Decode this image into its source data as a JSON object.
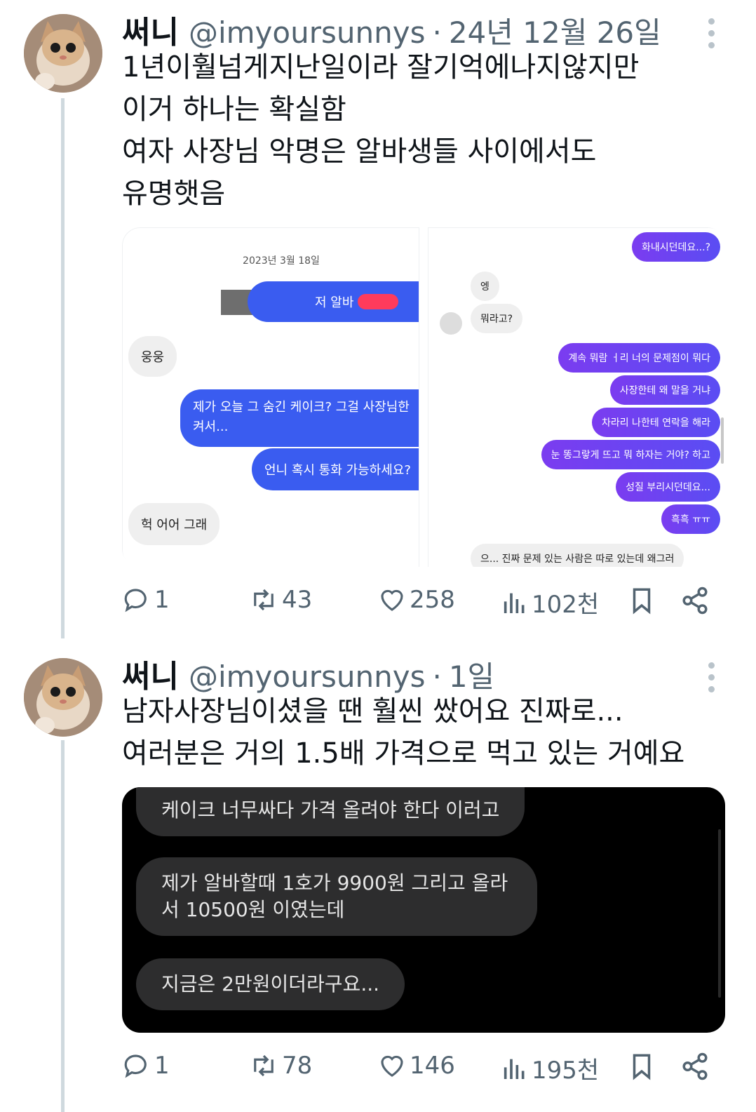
{
  "tweets": [
    {
      "author": "써니",
      "handle": "@imyoursunnys",
      "separator": "·",
      "date": "24년 12월 26일",
      "text": "1년이훨넘게지난일이라 잘기억에나지않지만\n이거 하나는 확실함\n여자 사장님 악명은 알바생들 사이에서도\n유명햇음",
      "left_screenshot": {
        "date": "2023년 3월 18일",
        "messages": [
          "저 알바",
          "웅웅",
          "제가 오늘 그 숨긴 케이크? 그걸 사장님한",
          "켜서...",
          "언니 혹시 통화 가능하세요?",
          "헉 어어 그래"
        ]
      },
      "right_screenshot": {
        "messages": [
          "화내시던데요...?",
          "엥",
          "뭐라고?",
          "계속 뭐람 ㅓ리 너의 문제점이 뭐다",
          "사장한테 왜 말을 거냐",
          "차라리 나한테 연락을 해라",
          "눈 똥그랗게 뜨고 뭐 하자는 거야? 하고",
          "성질 부리시던데요...",
          "흑흑 ㅠㅠ",
          "으... 진짜 문제 있는 사람은 따로 있는데 왜그러"
        ]
      },
      "stats": {
        "replies": "1",
        "reposts": "43",
        "likes": "258",
        "views": "102천"
      }
    },
    {
      "author": "써니",
      "handle": "@imyoursunnys",
      "separator": "·",
      "date": "1일",
      "text": "남자사장님이셨을 땐 훨씬 쌌어요 진짜로...\n여러분은 거의 1.5배 가격으로 먹고 있는 거예요",
      "chat": [
        "케이크 너무싸다 가격 올려야 한다 이러고",
        "제가 알바할때 1호가 9900원 그리고 올라\n서 10500원 이였는데",
        "지금은 2만원이더라구요..."
      ],
      "stats": {
        "replies": "1",
        "reposts": "78",
        "likes": "146",
        "views": "195천"
      }
    }
  ],
  "colors": {
    "thread_line": "#cfd9de",
    "muted": "#536471",
    "blue_bubble": "#3a5cf0",
    "purple_bubble": "#6a45f0",
    "dark_bg": "#000000"
  },
  "icons": [
    "reply-icon",
    "repost-icon",
    "like-icon",
    "views-icon",
    "bookmark-icon",
    "share-icon",
    "more-icon"
  ]
}
